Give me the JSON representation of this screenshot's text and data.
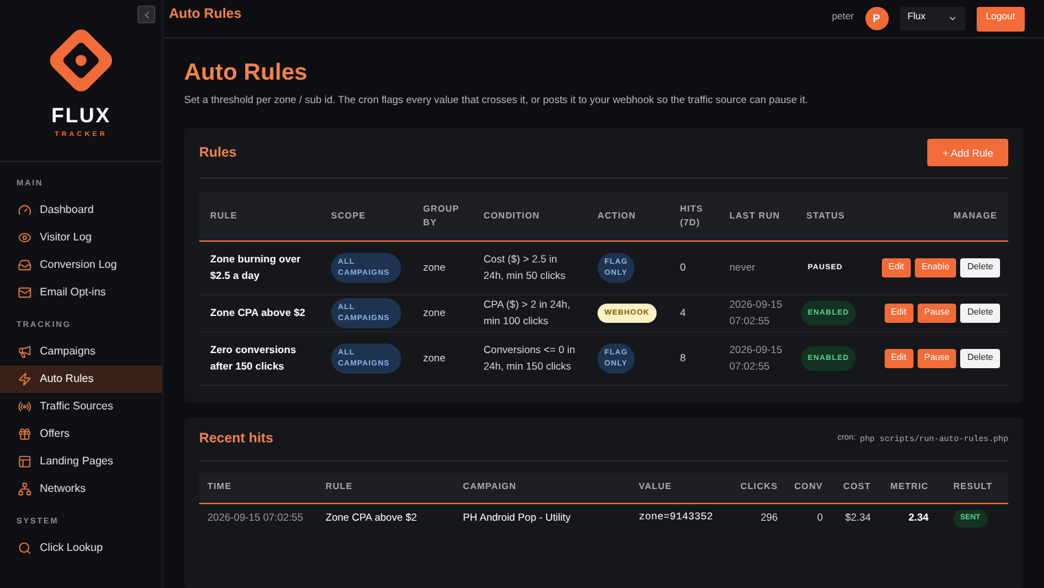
{
  "sidebar": {
    "logo": {
      "name": "FLUX",
      "tagline": "TRACKER"
    },
    "sections": [
      {
        "title": "MAIN",
        "items": [
          {
            "label": "Dashboard",
            "selected": false
          },
          {
            "label": "Visitor Log",
            "selected": false
          },
          {
            "label": "Conversion Log",
            "selected": false
          },
          {
            "label": "Email Opt-ins",
            "selected": false
          }
        ]
      },
      {
        "title": "TRACKING",
        "items": [
          {
            "label": "Campaigns",
            "selected": false
          },
          {
            "label": "Auto Rules",
            "selected": true
          },
          {
            "label": "Traffic Sources",
            "selected": false
          },
          {
            "label": "Offers",
            "selected": false
          },
          {
            "label": "Landing Pages",
            "selected": false
          },
          {
            "label": "Networks",
            "selected": false
          }
        ]
      },
      {
        "title": "SYSTEM",
        "items": [
          {
            "label": "Click Lookup",
            "selected": false
          }
        ]
      }
    ]
  },
  "topbar": {
    "title": "Auto Rules",
    "user": "peter",
    "avatar": "P",
    "workspace": "Flux",
    "logout": "Logout"
  },
  "page": {
    "title": "Auto Rules",
    "description": "Set a threshold per zone / sub id. The cron flags every value that crosses it, or posts it to your webhook so the traffic source can pause it."
  },
  "rules": {
    "title": "Rules",
    "add_button": "+ Add Rule",
    "columns": [
      "RULE",
      "SCOPE",
      "GROUP BY",
      "CONDITION",
      "ACTION",
      "HITS (7D)",
      "LAST RUN",
      "STATUS",
      "MANAGE"
    ],
    "rows": [
      {
        "rule": "Zone burning over $2.5 a day",
        "scope": "ALL CAMPAIGNS",
        "group_by": "zone",
        "condition": "Cost ($) > 2.5 in 24h, min 50 clicks",
        "action": {
          "label": "FLAG ONLY",
          "kind": "flag"
        },
        "hits": "0",
        "last_run": "never",
        "status": {
          "label": "PAUSED",
          "kind": "paused"
        },
        "buttons": [
          {
            "label": "Edit",
            "kind": "primary"
          },
          {
            "label": "Enable",
            "kind": "primary"
          },
          {
            "label": "Delete",
            "kind": "light"
          }
        ]
      },
      {
        "rule": "Zone CPA above $2",
        "scope": "ALL CAMPAIGNS",
        "group_by": "zone",
        "condition": "CPA ($) > 2 in 24h, min 100 clicks",
        "action": {
          "label": "WEBHOOK",
          "kind": "webhook"
        },
        "hits": "4",
        "last_run": "2026-09-15 07:02:55",
        "status": {
          "label": "ENABLED",
          "kind": "enabled"
        },
        "buttons": [
          {
            "label": "Edit",
            "kind": "primary"
          },
          {
            "label": "Pause",
            "kind": "primary"
          },
          {
            "label": "Delete",
            "kind": "light"
          }
        ]
      },
      {
        "rule": "Zero conversions after 150 clicks",
        "scope": "ALL CAMPAIGNS",
        "group_by": "zone",
        "condition": "Conversions <= 0 in 24h, min 150 clicks",
        "action": {
          "label": "FLAG ONLY",
          "kind": "flag"
        },
        "hits": "8",
        "last_run": "2026-09-15 07:02:55",
        "status": {
          "label": "ENABLED",
          "kind": "enabled"
        },
        "buttons": [
          {
            "label": "Edit",
            "kind": "primary"
          },
          {
            "label": "Pause",
            "kind": "primary"
          },
          {
            "label": "Delete",
            "kind": "light"
          }
        ]
      }
    ]
  },
  "recent_hits": {
    "title": "Recent hits",
    "cron_label": "cron:",
    "cron_command": "php scripts/run-auto-rules.php",
    "columns": [
      "TIME",
      "RULE",
      "CAMPAIGN",
      "VALUE",
      "CLICKS",
      "CONV",
      "COST",
      "METRIC",
      "RESULT"
    ],
    "rows": [
      {
        "time": "2026-09-15 07:02:55",
        "rule": "Zone CPA above $2",
        "campaign": "PH Android Pop - Utility",
        "value": "zone=9143352",
        "clicks": "296",
        "conv": "0",
        "cost": "$2.34",
        "metric": "2.34",
        "result": {
          "label": "SENT",
          "kind": "sent"
        }
      }
    ]
  }
}
